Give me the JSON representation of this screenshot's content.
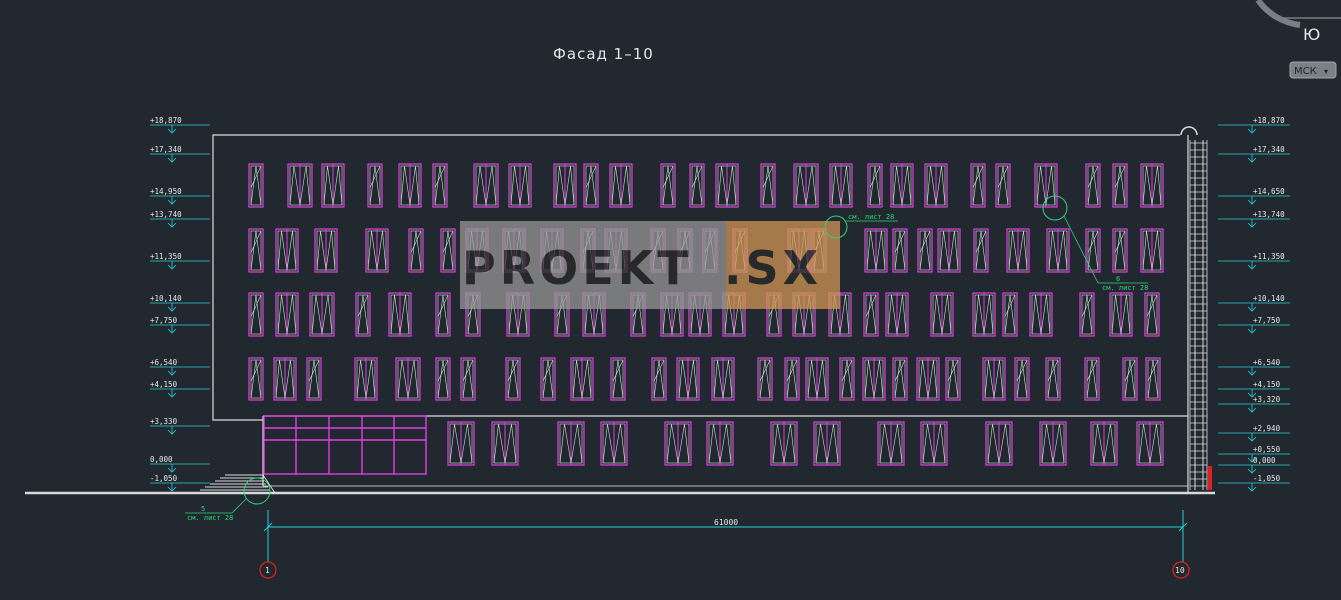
{
  "drawing": {
    "title": "Фасад 1–10",
    "dimension_total": "61000"
  },
  "viewcube": {
    "direction_label": "Ю",
    "ucs_button_label": "МСК"
  },
  "levels_left": [
    "+18,870",
    "+17,340",
    "+14,950",
    "+13,740",
    "+11,350",
    "+10,140",
    "+7,750",
    "+6,540",
    "+4,150",
    "+3,330",
    "0,000",
    "-1,050"
  ],
  "levels_right": [
    "+18,870",
    "+17,340",
    "+14,650",
    "+13,740",
    "+11,350",
    "+10,140",
    "+7,750",
    "+6,540",
    "+4,150",
    "+3,320",
    "+2,940",
    "+0,550",
    "0,000",
    "-1,050"
  ],
  "callouts": {
    "top_ref": "см. лист 28",
    "mid_number": "6",
    "mid_ref": "см. лист 28",
    "bottom_number": "5",
    "bottom_ref": "см. лист 28"
  },
  "axes": {
    "left": "1",
    "right": "10"
  },
  "watermark": {
    "text_main": "PROEKT",
    "text_domain": ".SX"
  },
  "colors": {
    "background": "#212830",
    "window": "#e040e0",
    "dimension": "#28d0d8",
    "note": "#2fd47a",
    "axis_marker": "#e02020"
  }
}
